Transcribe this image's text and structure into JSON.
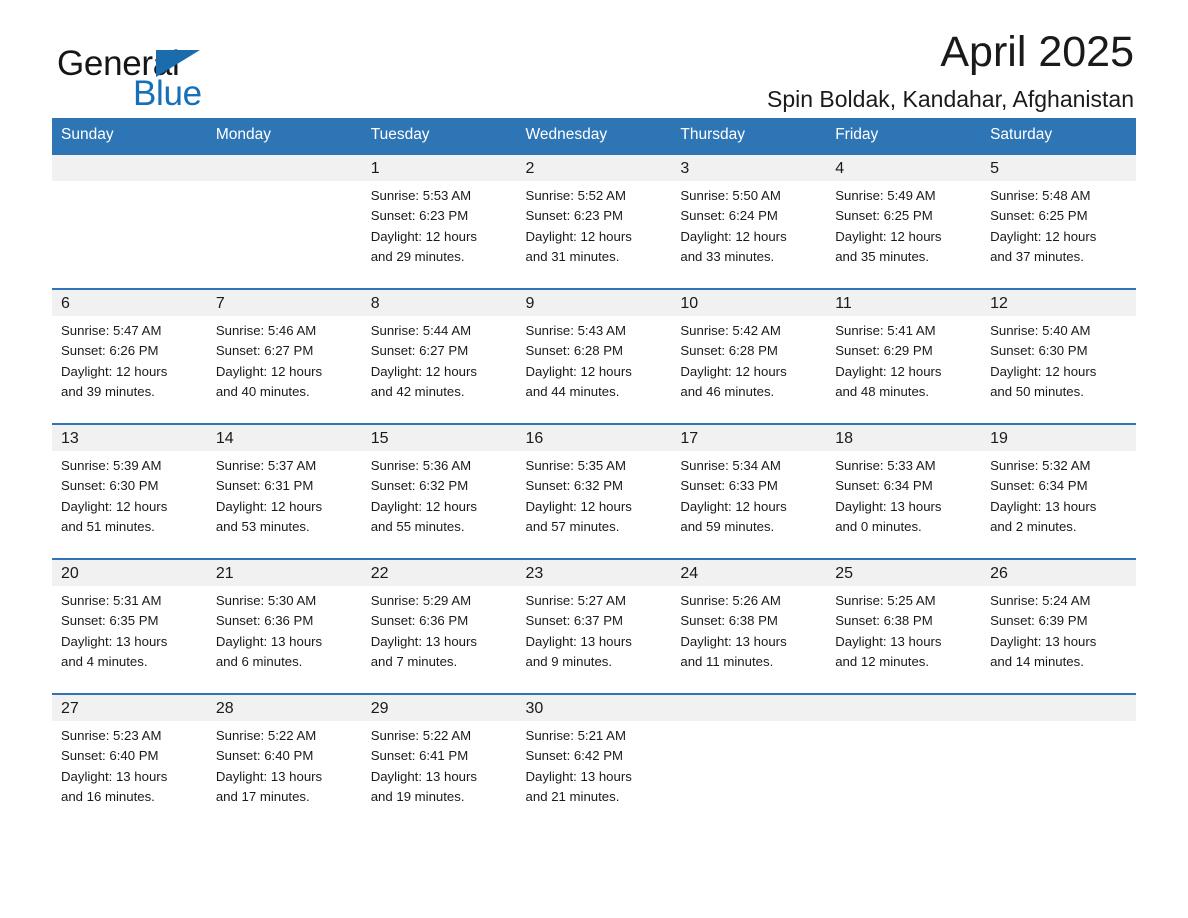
{
  "brand": {
    "word_dark": "General",
    "word_blue": "Blue",
    "triangle_icon": "brand-triangle-icon",
    "accent_color": "#1570b8"
  },
  "header": {
    "title": "April 2025",
    "subtitle": "Spin Boldak, Kandahar, Afghanistan"
  },
  "theme": {
    "header_blue": "#2e75b6",
    "row_line_blue": "#2e75b6",
    "daynum_band": "#f1f1f1",
    "text": "#1a1a1a"
  },
  "calendar": {
    "weekday_headers": [
      "Sunday",
      "Monday",
      "Tuesday",
      "Wednesday",
      "Thursday",
      "Friday",
      "Saturday"
    ],
    "labels": {
      "sunrise": "Sunrise:",
      "sunset": "Sunset:",
      "daylight": "Daylight:"
    },
    "weeks": [
      [
        {
          "day": "",
          "sunrise": "",
          "sunset": "",
          "daylight_1": "",
          "daylight_2": ""
        },
        {
          "day": "",
          "sunrise": "",
          "sunset": "",
          "daylight_1": "",
          "daylight_2": ""
        },
        {
          "day": "1",
          "sunrise": "Sunrise: 5:53 AM",
          "sunset": "Sunset: 6:23 PM",
          "daylight_1": "Daylight: 12 hours",
          "daylight_2": "and 29 minutes."
        },
        {
          "day": "2",
          "sunrise": "Sunrise: 5:52 AM",
          "sunset": "Sunset: 6:23 PM",
          "daylight_1": "Daylight: 12 hours",
          "daylight_2": "and 31 minutes."
        },
        {
          "day": "3",
          "sunrise": "Sunrise: 5:50 AM",
          "sunset": "Sunset: 6:24 PM",
          "daylight_1": "Daylight: 12 hours",
          "daylight_2": "and 33 minutes."
        },
        {
          "day": "4",
          "sunrise": "Sunrise: 5:49 AM",
          "sunset": "Sunset: 6:25 PM",
          "daylight_1": "Daylight: 12 hours",
          "daylight_2": "and 35 minutes."
        },
        {
          "day": "5",
          "sunrise": "Sunrise: 5:48 AM",
          "sunset": "Sunset: 6:25 PM",
          "daylight_1": "Daylight: 12 hours",
          "daylight_2": "and 37 minutes."
        }
      ],
      [
        {
          "day": "6",
          "sunrise": "Sunrise: 5:47 AM",
          "sunset": "Sunset: 6:26 PM",
          "daylight_1": "Daylight: 12 hours",
          "daylight_2": "and 39 minutes."
        },
        {
          "day": "7",
          "sunrise": "Sunrise: 5:46 AM",
          "sunset": "Sunset: 6:27 PM",
          "daylight_1": "Daylight: 12 hours",
          "daylight_2": "and 40 minutes."
        },
        {
          "day": "8",
          "sunrise": "Sunrise: 5:44 AM",
          "sunset": "Sunset: 6:27 PM",
          "daylight_1": "Daylight: 12 hours",
          "daylight_2": "and 42 minutes."
        },
        {
          "day": "9",
          "sunrise": "Sunrise: 5:43 AM",
          "sunset": "Sunset: 6:28 PM",
          "daylight_1": "Daylight: 12 hours",
          "daylight_2": "and 44 minutes."
        },
        {
          "day": "10",
          "sunrise": "Sunrise: 5:42 AM",
          "sunset": "Sunset: 6:28 PM",
          "daylight_1": "Daylight: 12 hours",
          "daylight_2": "and 46 minutes."
        },
        {
          "day": "11",
          "sunrise": "Sunrise: 5:41 AM",
          "sunset": "Sunset: 6:29 PM",
          "daylight_1": "Daylight: 12 hours",
          "daylight_2": "and 48 minutes."
        },
        {
          "day": "12",
          "sunrise": "Sunrise: 5:40 AM",
          "sunset": "Sunset: 6:30 PM",
          "daylight_1": "Daylight: 12 hours",
          "daylight_2": "and 50 minutes."
        }
      ],
      [
        {
          "day": "13",
          "sunrise": "Sunrise: 5:39 AM",
          "sunset": "Sunset: 6:30 PM",
          "daylight_1": "Daylight: 12 hours",
          "daylight_2": "and 51 minutes."
        },
        {
          "day": "14",
          "sunrise": "Sunrise: 5:37 AM",
          "sunset": "Sunset: 6:31 PM",
          "daylight_1": "Daylight: 12 hours",
          "daylight_2": "and 53 minutes."
        },
        {
          "day": "15",
          "sunrise": "Sunrise: 5:36 AM",
          "sunset": "Sunset: 6:32 PM",
          "daylight_1": "Daylight: 12 hours",
          "daylight_2": "and 55 minutes."
        },
        {
          "day": "16",
          "sunrise": "Sunrise: 5:35 AM",
          "sunset": "Sunset: 6:32 PM",
          "daylight_1": "Daylight: 12 hours",
          "daylight_2": "and 57 minutes."
        },
        {
          "day": "17",
          "sunrise": "Sunrise: 5:34 AM",
          "sunset": "Sunset: 6:33 PM",
          "daylight_1": "Daylight: 12 hours",
          "daylight_2": "and 59 minutes."
        },
        {
          "day": "18",
          "sunrise": "Sunrise: 5:33 AM",
          "sunset": "Sunset: 6:34 PM",
          "daylight_1": "Daylight: 13 hours",
          "daylight_2": "and 0 minutes."
        },
        {
          "day": "19",
          "sunrise": "Sunrise: 5:32 AM",
          "sunset": "Sunset: 6:34 PM",
          "daylight_1": "Daylight: 13 hours",
          "daylight_2": "and 2 minutes."
        }
      ],
      [
        {
          "day": "20",
          "sunrise": "Sunrise: 5:31 AM",
          "sunset": "Sunset: 6:35 PM",
          "daylight_1": "Daylight: 13 hours",
          "daylight_2": "and 4 minutes."
        },
        {
          "day": "21",
          "sunrise": "Sunrise: 5:30 AM",
          "sunset": "Sunset: 6:36 PM",
          "daylight_1": "Daylight: 13 hours",
          "daylight_2": "and 6 minutes."
        },
        {
          "day": "22",
          "sunrise": "Sunrise: 5:29 AM",
          "sunset": "Sunset: 6:36 PM",
          "daylight_1": "Daylight: 13 hours",
          "daylight_2": "and 7 minutes."
        },
        {
          "day": "23",
          "sunrise": "Sunrise: 5:27 AM",
          "sunset": "Sunset: 6:37 PM",
          "daylight_1": "Daylight: 13 hours",
          "daylight_2": "and 9 minutes."
        },
        {
          "day": "24",
          "sunrise": "Sunrise: 5:26 AM",
          "sunset": "Sunset: 6:38 PM",
          "daylight_1": "Daylight: 13 hours",
          "daylight_2": "and 11 minutes."
        },
        {
          "day": "25",
          "sunrise": "Sunrise: 5:25 AM",
          "sunset": "Sunset: 6:38 PM",
          "daylight_1": "Daylight: 13 hours",
          "daylight_2": "and 12 minutes."
        },
        {
          "day": "26",
          "sunrise": "Sunrise: 5:24 AM",
          "sunset": "Sunset: 6:39 PM",
          "daylight_1": "Daylight: 13 hours",
          "daylight_2": "and 14 minutes."
        }
      ],
      [
        {
          "day": "27",
          "sunrise": "Sunrise: 5:23 AM",
          "sunset": "Sunset: 6:40 PM",
          "daylight_1": "Daylight: 13 hours",
          "daylight_2": "and 16 minutes."
        },
        {
          "day": "28",
          "sunrise": "Sunrise: 5:22 AM",
          "sunset": "Sunset: 6:40 PM",
          "daylight_1": "Daylight: 13 hours",
          "daylight_2": "and 17 minutes."
        },
        {
          "day": "29",
          "sunrise": "Sunrise: 5:22 AM",
          "sunset": "Sunset: 6:41 PM",
          "daylight_1": "Daylight: 13 hours",
          "daylight_2": "and 19 minutes."
        },
        {
          "day": "30",
          "sunrise": "Sunrise: 5:21 AM",
          "sunset": "Sunset: 6:42 PM",
          "daylight_1": "Daylight: 13 hours",
          "daylight_2": "and 21 minutes."
        },
        {
          "day": "",
          "sunrise": "",
          "sunset": "",
          "daylight_1": "",
          "daylight_2": ""
        },
        {
          "day": "",
          "sunrise": "",
          "sunset": "",
          "daylight_1": "",
          "daylight_2": ""
        },
        {
          "day": "",
          "sunrise": "",
          "sunset": "",
          "daylight_1": "",
          "daylight_2": ""
        }
      ]
    ]
  }
}
